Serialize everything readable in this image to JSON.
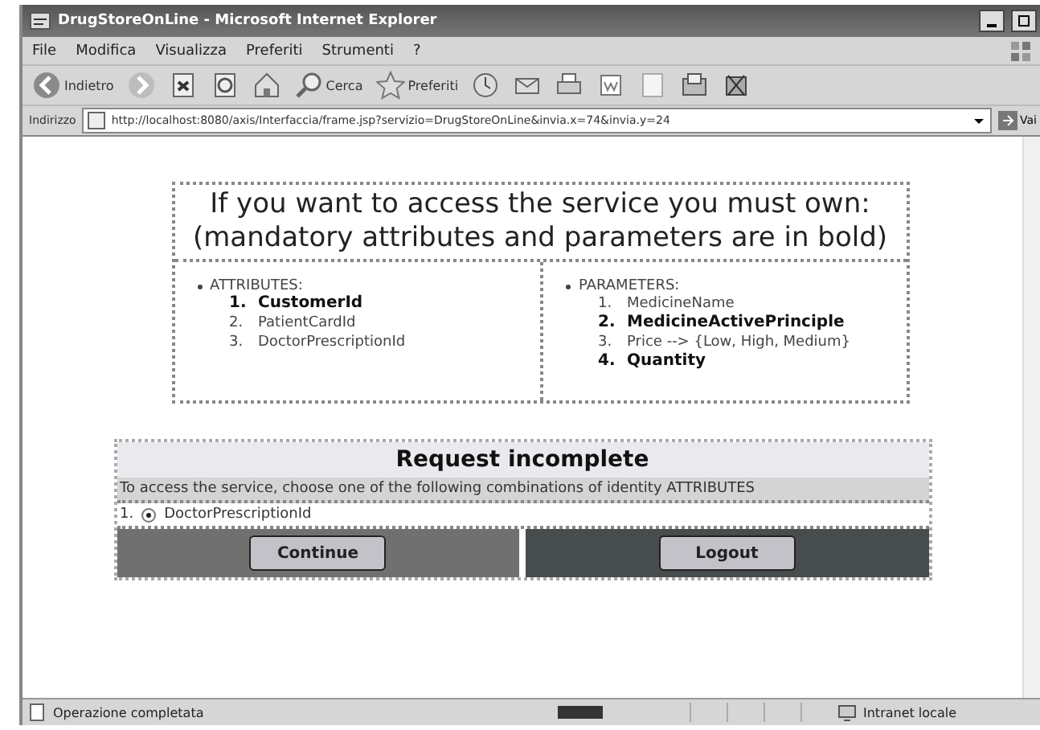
{
  "window": {
    "title": "DrugStoreOnLine - Microsoft Internet Explorer"
  },
  "menu": [
    "File",
    "Modifica",
    "Visualizza",
    "Preferiti",
    "Strumenti",
    "?"
  ],
  "toolbar": [
    {
      "kind": "back",
      "label": "Indietro"
    },
    {
      "kind": "forward"
    },
    {
      "kind": "stop"
    },
    {
      "kind": "refresh"
    },
    {
      "kind": "home"
    },
    {
      "kind": "search",
      "label": "Cerca"
    },
    {
      "kind": "favorites",
      "label": "Preferiti"
    },
    {
      "kind": "history"
    },
    {
      "kind": "mail"
    },
    {
      "kind": "print"
    },
    {
      "kind": "edit"
    },
    {
      "kind": "page"
    },
    {
      "kind": "folder"
    },
    {
      "kind": "tools"
    }
  ],
  "address": {
    "label": "Indirizzo",
    "url": "http://localhost:8080/axis/Interfaccia/frame.jsp?servizio=DrugStoreOnLine&invia.x=74&invia.y=24",
    "go": "Vai"
  },
  "notice": {
    "lines": [
      "If you want to access the service you must own:",
      "(mandatory attributes and parameters are in bold)"
    ]
  },
  "lists": [
    {
      "label": "ATTRIBUTES:",
      "items": [
        {
          "number": "1.",
          "name": "CustomerId",
          "mandatory": true
        },
        {
          "number": "2.",
          "name": "PatientCardId",
          "mandatory": false
        },
        {
          "number": "3.",
          "name": "DoctorPrescriptionId",
          "mandatory": false
        }
      ]
    },
    {
      "label": "PARAMETERS:",
      "items": [
        {
          "number": "1.",
          "name": "MedicineName",
          "mandatory": false
        },
        {
          "number": "2.",
          "name": "MedicineActivePrinciple",
          "mandatory": true
        },
        {
          "number": "3.",
          "name": "Price --> {Low, High, Medium}",
          "mandatory": false
        },
        {
          "number": "4.",
          "name": "Quantity",
          "mandatory": true
        }
      ]
    }
  ],
  "request": {
    "title": "Request incomplete",
    "instruction": "To access the service, choose one of the following combinations of identity ATTRIBUTES",
    "options": [
      {
        "number": "1.",
        "label": "DoctorPrescriptionId",
        "selected": true
      }
    ],
    "buttons": [
      "Continue",
      "Logout"
    ]
  },
  "status_bar": {
    "text": "Operazione completata",
    "zone": "Intranet locale"
  }
}
